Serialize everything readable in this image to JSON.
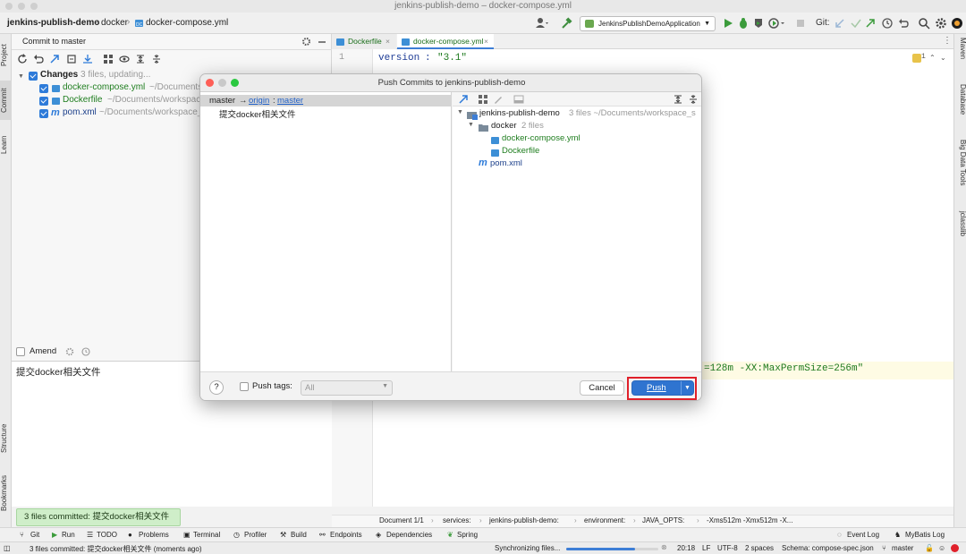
{
  "window": {
    "title": "jenkins-publish-demo – docker-compose.yml"
  },
  "navbar": {
    "project": "jenkins-publish-demo",
    "folder": "docker",
    "file": "docker-compose.yml",
    "run_config": "JenkinsPublishDemoApplication",
    "git_label": "Git:"
  },
  "left_strip": {
    "tabs": [
      "Project",
      "Commit",
      "Learn",
      "Structure",
      "Bookmarks"
    ]
  },
  "right_strip": {
    "tabs": [
      "Maven",
      "Database",
      "Big Data Tools",
      "jclasslib"
    ]
  },
  "commit_panel": {
    "header": "Commit to master",
    "changes_label": "Changes",
    "changes_status": "3 files, updating...",
    "files": [
      {
        "name": "docker-compose.yml",
        "path": "~/Documents/"
      },
      {
        "name": "Dockerfile",
        "path": "~/Documents/workspac"
      },
      {
        "name": "pom.xml",
        "path": "~/Documents/workspace_"
      }
    ],
    "amend_label": "Amend",
    "message": "提交docker相关文件"
  },
  "editor": {
    "tabs": [
      "Dockerfile",
      "docker-compose.yml"
    ],
    "line_numbers": [
      "1"
    ],
    "line1_key": "version",
    "line1_value": "\"3.1\"",
    "highlight_line": "=128m -XX:MaxPermSize=256m\"",
    "inspection_count": "1",
    "breadcrumbs": [
      "Document 1/1",
      "services:",
      "jenkins-publish-demo:",
      "environment:",
      "JAVA_OPTS:",
      "-Xms512m -Xmx512m -X..."
    ]
  },
  "dialog": {
    "title": "Push Commits to jenkins-publish-demo",
    "branch_local": "master",
    "arrow": "→",
    "remote": "origin",
    "remote_sep": ":",
    "branch_remote": "master",
    "commit_message": "提交docker相关文件",
    "tree_root": "jenkins-publish-demo",
    "tree_root_info": "3 files ~/Documents/workspace_s",
    "tree_folder": "docker",
    "tree_folder_info": "2 files",
    "tree_files_docker": [
      "docker-compose.yml",
      "Dockerfile"
    ],
    "tree_file_root": "pom.xml",
    "push_tags_label": "Push tags:",
    "push_tags_value": "All",
    "cancel_label": "Cancel",
    "push_label": "Push",
    "help_label": "?"
  },
  "toast": "3 files committed: 提交docker相关文件",
  "bottom_tools": [
    "Git",
    "Run",
    "TODO",
    "Problems",
    "Terminal",
    "Profiler",
    "Build",
    "Endpoints",
    "Dependencies",
    "Spring"
  ],
  "bottom_tools_right": [
    "Event Log",
    "MyBatis Log"
  ],
  "statusbar": {
    "message": "3 files committed: 提交docker相关文件 (moments ago)",
    "sync": "Synchronizing files...",
    "sync_progress": 0.75,
    "position": "20:18",
    "line_sep": "LF",
    "encoding": "UTF-8",
    "indent": "2 spaces",
    "schema": "Schema: compose-spec.json",
    "branch": "master"
  },
  "colors": {
    "accent": "#2e7bd9",
    "push_button": "#2f74d0",
    "highlight_border": "#e0202a",
    "toast_bg": "#cfeec9"
  }
}
